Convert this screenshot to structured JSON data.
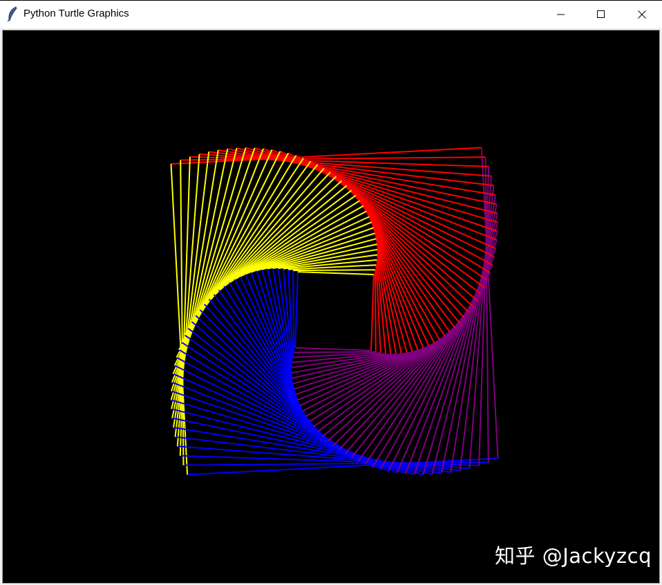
{
  "window": {
    "title": "Python Turtle Graphics",
    "app_icon": "feather-icon",
    "controls": {
      "minimize_icon": "minimize-icon",
      "maximize_icon": "maximize-icon",
      "close_icon": "close-icon"
    }
  },
  "canvas": {
    "background": "#000000",
    "colors": [
      "#ff0000",
      "#800080",
      "#0000ff",
      "#ffff00"
    ],
    "watermark": "知乎 @Jackyzcq"
  }
}
